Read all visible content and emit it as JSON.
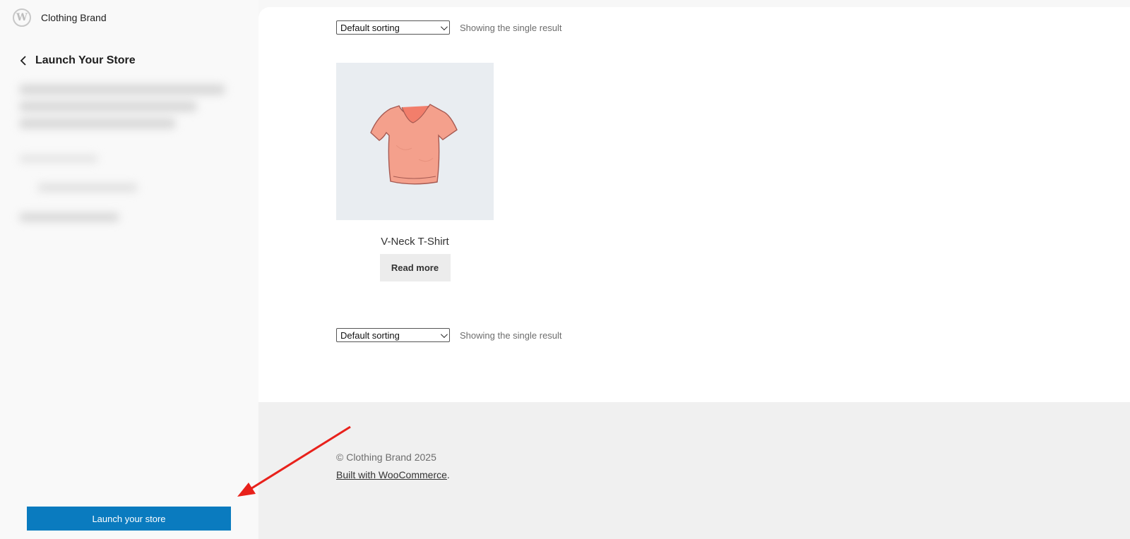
{
  "sidebar": {
    "site_name": "Clothing Brand",
    "logo_icon": "wordpress-logo-icon",
    "panel_title": "Launch Your Store",
    "back_icon": "chevron-left-icon",
    "launch_button_label": "Launch your store",
    "launch_button_color": "#0a7bbf"
  },
  "shop": {
    "sorting_top": "Default sorting",
    "result_count_top": "Showing the single result",
    "sorting_bottom": "Default sorting",
    "result_count_bottom": "Showing the single result",
    "product": {
      "name": "V-Neck T-Shirt",
      "button_label": "Read more",
      "image_icon": "t-shirt-icon",
      "shirt_color": "#f4a08c"
    }
  },
  "footer": {
    "copyright": "© Clothing Brand 2025",
    "built_with_link": "Built with WooCommerce",
    "built_with_suffix": "."
  },
  "annotation": {
    "arrow_color": "#e8211b"
  }
}
